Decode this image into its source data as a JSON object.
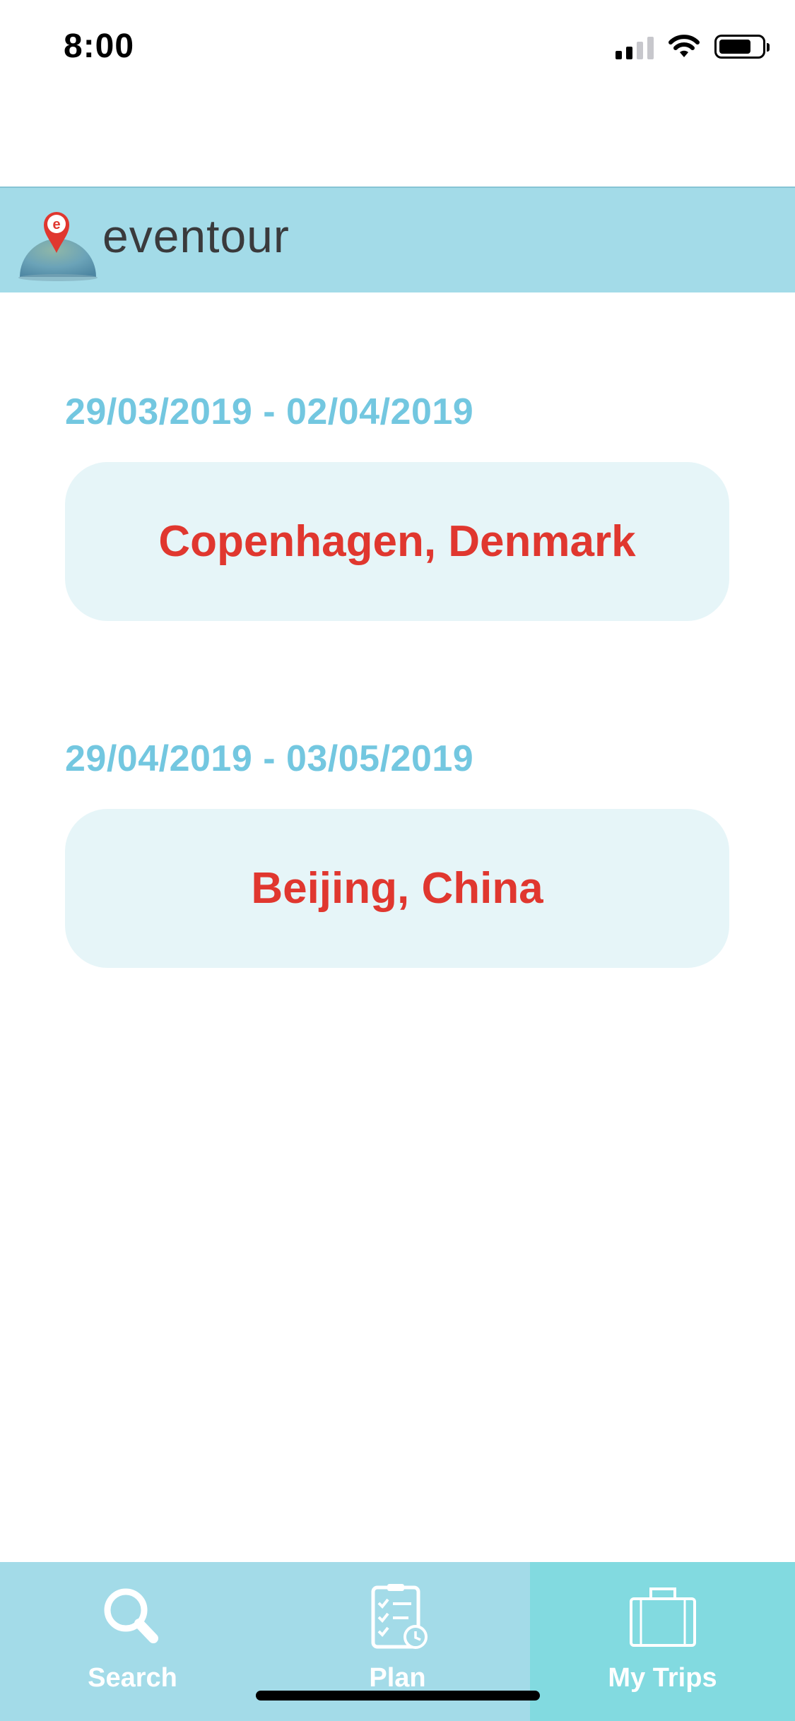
{
  "status_bar": {
    "time": "8:00",
    "signal_icon": "cellular-signal-icon",
    "wifi_icon": "wifi-icon",
    "battery_icon": "battery-icon"
  },
  "header": {
    "logo_icon": "globe-location-pin-icon",
    "brand": "eventour"
  },
  "trips": [
    {
      "dates": "29/03/2019 - 02/04/2019",
      "destination": "Copenhagen, Denmark"
    },
    {
      "dates": "29/04/2019 - 03/05/2019",
      "destination": "Beijing, China"
    }
  ],
  "tabbar": {
    "tabs": [
      {
        "label": "Search",
        "icon": "magnifier-icon",
        "active": false
      },
      {
        "label": "Plan",
        "icon": "checklist-clock-icon",
        "active": false
      },
      {
        "label": "My Trips",
        "icon": "suitcase-icon",
        "active": true
      }
    ]
  },
  "colors": {
    "header_bg": "#a3dbe8",
    "tab_bg": "#a3dbe8",
    "tab_active_bg": "#82dae0",
    "date_text": "#73c7e0",
    "destination_text": "#e0372f",
    "card_bg": "#e6f5f8"
  }
}
